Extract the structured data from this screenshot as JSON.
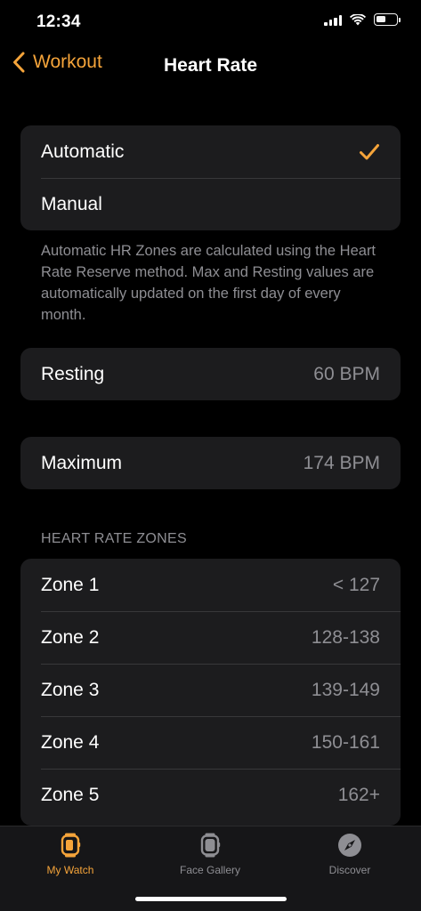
{
  "status_bar": {
    "time": "12:34"
  },
  "nav": {
    "back_label": "Workout",
    "title": "Heart Rate"
  },
  "mode_options": [
    {
      "label": "Automatic",
      "selected": true
    },
    {
      "label": "Manual",
      "selected": false
    }
  ],
  "check_glyph": "✓",
  "description": "Automatic HR Zones are calculated using the Heart Rate Reserve method. Max and Resting values are automatically updated on the first day of every month.",
  "resting": {
    "label": "Resting",
    "value": "60 BPM"
  },
  "maximum": {
    "label": "Maximum",
    "value": "174 BPM"
  },
  "zones_header": "HEART RATE ZONES",
  "zones": [
    {
      "label": "Zone 1",
      "value": "< 127"
    },
    {
      "label": "Zone 2",
      "value": "128-138"
    },
    {
      "label": "Zone 3",
      "value": "139-149"
    },
    {
      "label": "Zone 4",
      "value": "150-161"
    },
    {
      "label": "Zone 5",
      "value": "162+"
    }
  ],
  "tabs": [
    {
      "label": "My Watch",
      "icon": "watch-icon",
      "active": true
    },
    {
      "label": "Face Gallery",
      "icon": "face-gallery-icon",
      "active": false
    },
    {
      "label": "Discover",
      "icon": "compass-icon",
      "active": false
    }
  ],
  "colors": {
    "accent": "#f5a43a",
    "card": "#1c1c1e",
    "secondary_text": "#8e8e93",
    "background": "#000000"
  }
}
